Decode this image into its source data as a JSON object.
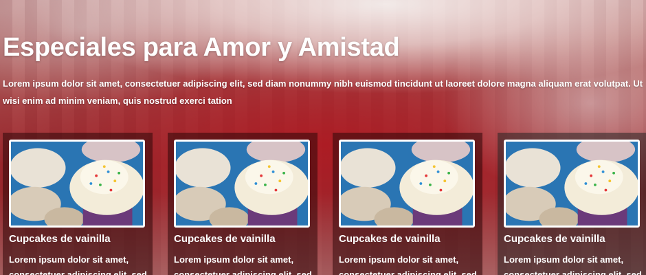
{
  "hero": {
    "title_main": "Especiales",
    "title_rest": "para Amor y Amistad",
    "intro": "Lorem ipsum dolor sit amet, consectetuer adipiscing elit, sed diam nonummy nibh euismod tincidunt ut laoreet dolore magna aliquam erat volutpat. Ut wisi enim ad minim veniam, quis nostrud exerci tation"
  },
  "cards": [
    {
      "title": "Cupcakes de vainilla",
      "text": "Lorem ipsum dolor sit amet, consectetuer adipiscing elit, sed"
    },
    {
      "title": "Cupcakes de vainilla",
      "text": "Lorem ipsum dolor sit amet, consectetuer adipiscing elit, sed"
    },
    {
      "title": "Cupcakes de vainilla",
      "text": "Lorem ipsum dolor sit amet, consectetuer adipiscing elit, sed"
    },
    {
      "title": "Cupcakes de vainilla",
      "text": "Lorem ipsum dolor sit amet, consectetuer adipiscing elit, sed"
    }
  ],
  "colors": {
    "text": "#ffffff",
    "card_bg": "#300808",
    "thumb_border": "#ffffff"
  }
}
